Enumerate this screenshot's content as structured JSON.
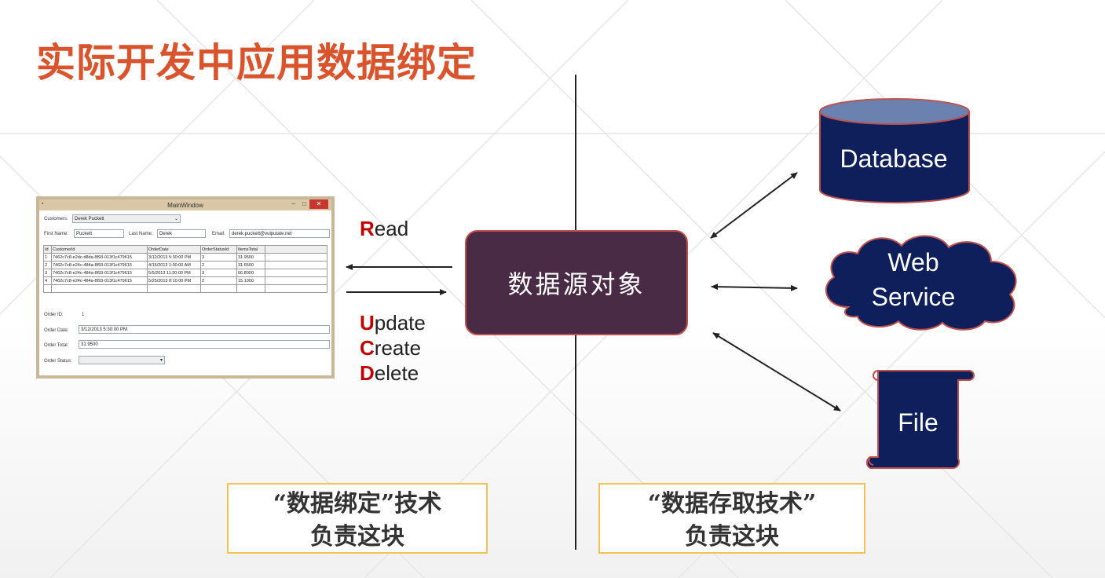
{
  "title": "实际开发中应用数据绑定",
  "window": {
    "title": "MainWindow",
    "customers_label": "Customers:",
    "customers_value": "Derek Puckett",
    "first_name_label": "First Name:",
    "first_name_value": "Puckett",
    "last_name_label": "Last Name:",
    "last_name_value": "Derek",
    "email_label": "Email:",
    "email_value": "derek.puckett@vulputate.net",
    "grid_headers": [
      "Id",
      "CustomerId",
      "OrderDate",
      "OrderStatusId",
      "ItemsTotal"
    ],
    "grid_rows": [
      [
        "1",
        "7462c7c8-e2dc-d8da-8f93-013f1c479615",
        "3/12/2013 5:30:00 PM",
        "3",
        "31.9500"
      ],
      [
        "2",
        "7462c7c8-e24c-484a-8f93-013f1c479615",
        "4/15/2013 1:00:00 AM",
        "2",
        "31.6500"
      ],
      [
        "3",
        "7462c7c8-e24c-484a-8f93-013f1c479615",
        "5/5/2013 11:30:00 PM",
        "3",
        "66.8000"
      ],
      [
        "4",
        "7462c7c8-e24c-484a-8f93-013f1c479615",
        "5/25/2013 8:10:00 PM",
        "2",
        "15.1000"
      ]
    ],
    "order_id_label": "Order ID:",
    "order_id_value": "1",
    "order_date_label": "Order Date:",
    "order_date_value": "3/12/2013 5:30:00 PM",
    "order_total_label": "Order Total:",
    "order_total_value": "31.9500",
    "order_status_label": "Order Status:",
    "order_status_value": ""
  },
  "read": {
    "letter": "R",
    "rest": "ead"
  },
  "update": {
    "letter": "U",
    "rest": "pdate"
  },
  "create": {
    "letter": "C",
    "rest": "reate"
  },
  "delete": {
    "letter": "D",
    "rest": "elete"
  },
  "center_label": "数据源对象",
  "stores": {
    "database": "Database",
    "web_line1": "Web",
    "web_line2": "Service",
    "file": "File"
  },
  "notes": {
    "left_line1": "“数据绑定”技术",
    "left_line2": "负责这块",
    "right_line1": "“数据存取技术”",
    "right_line2": "负责这块"
  },
  "colors": {
    "title": "#d9532c",
    "center_box": "#4a2b45",
    "store_fill": "#0f1f5c",
    "highlight": "#c00000",
    "note_border": "#f3c154"
  }
}
